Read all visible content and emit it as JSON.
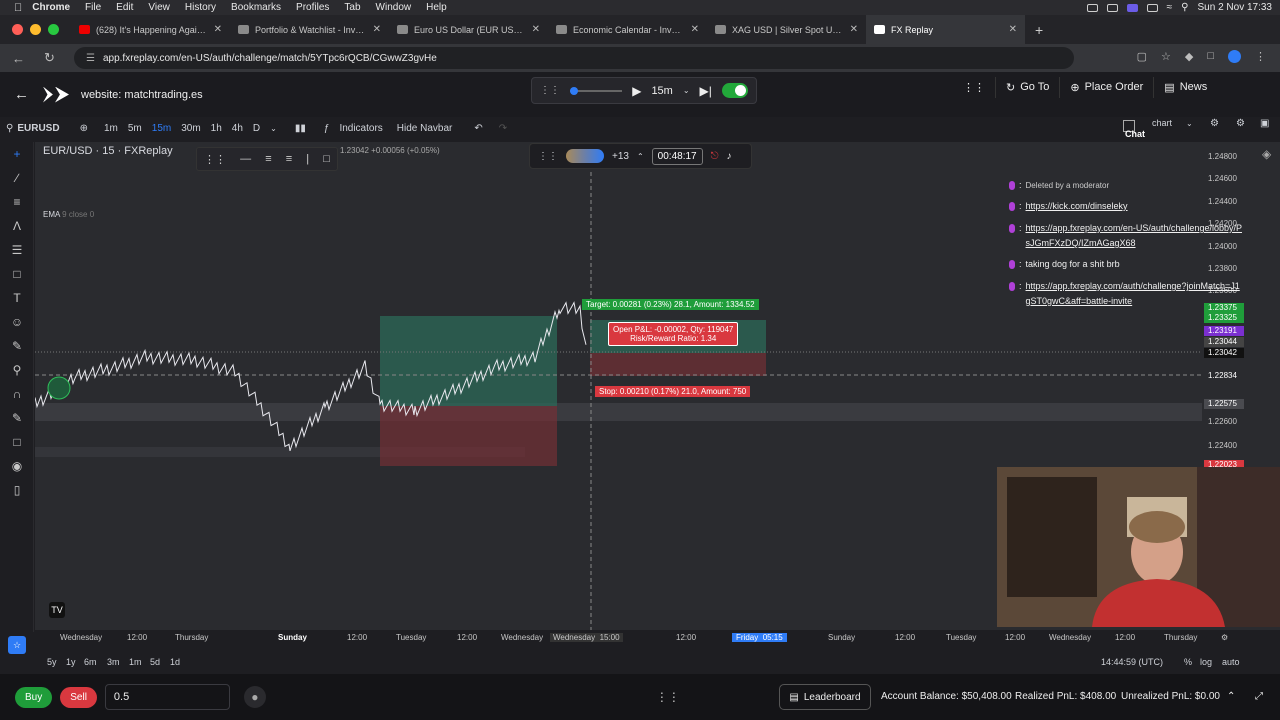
{
  "mac_menu": {
    "app": "Chrome",
    "items": [
      "File",
      "Edit",
      "View",
      "History",
      "Bookmarks",
      "Profiles",
      "Tab",
      "Window",
      "Help"
    ],
    "clock": "Sun 2 Nov  17:33"
  },
  "browser": {
    "tabs": [
      {
        "title": "(628) It's Happening Again a",
        "active": false
      },
      {
        "title": "Portfolio & Watchlist - Investi",
        "active": false
      },
      {
        "title": "Euro US Dollar (EUR USD) Ne",
        "active": false
      },
      {
        "title": "Economic Calendar - Investin",
        "active": false
      },
      {
        "title": "XAG USD | Silver Spot US Do",
        "active": false
      },
      {
        "title": "FX Replay",
        "active": true
      }
    ],
    "url": "app.fxreplay.com/en-US/auth/challenge/match/5YTpc6rQCB/CGwwZ3gvHe"
  },
  "header": {
    "site_label": "website: matchtrading.es",
    "timeframe": "15m",
    "go_to": "Go To",
    "place_order": "Place Order",
    "news": "News"
  },
  "toolbar": {
    "symbol": "EURUSD",
    "intervals": [
      "1m",
      "5m",
      "15m",
      "30m",
      "1h",
      "4h",
      "D"
    ],
    "active_interval": "15m",
    "indicators": "Indicators",
    "hide_navbar": "Hide Navbar",
    "chart_label": "chart",
    "chat_label": "Chat"
  },
  "chart": {
    "legend_symbol": "EUR/USD · 15 · FXReplay",
    "legend_change": "1.23042  +0.00056 (+0.05%)",
    "ema_label": "EMA",
    "ema_params": "9 close 0",
    "participants": "+13",
    "timer": "00:48:17",
    "target_label": "Target: 0.00281 (0.23%) 28.1, Amount: 1334.52",
    "pnl_line1": "Open P&L: -0.00002, Qty: 119047",
    "pnl_line2": "Risk/Reward Ratio: 1.34",
    "stop_label": "Stop: 0.00210 (0.17%) 21.0, Amount: 750",
    "y_ticks": [
      "1.24800",
      "1.24600",
      "1.24400",
      "1.24200",
      "1.24000",
      "1.23800",
      "1.23600",
      "1.23400",
      "1.23200",
      "1.22800",
      "1.22600",
      "1.22400",
      "1.22200"
    ],
    "y_tags": [
      {
        "v": "1.23375",
        "c": "#1f9d3a"
      },
      {
        "v": "1.23325",
        "c": "#1f9d3a"
      },
      {
        "v": "1.23191",
        "c": "#8a2be2"
      },
      {
        "v": "1.23044",
        "c": "#555"
      },
      {
        "v": "1.23042",
        "c": "#222"
      },
      {
        "v": "1.22834",
        "c": "#3a3a40"
      },
      {
        "v": "1.22575",
        "c": "#555"
      },
      {
        "v": "1.22023",
        "c": "#d9383f"
      }
    ],
    "x_ticks": [
      "Wednesday",
      "12:00",
      "Thursday",
      "Sunday",
      "12:00",
      "Tuesday",
      "12:00",
      "Wednesday",
      "Wednesday",
      "15:00",
      "12:00",
      "Friday",
      "05:15",
      "Sunday",
      "12:00",
      "Tuesday",
      "12:00",
      "Wednesday",
      "12:00",
      "Thursday"
    ]
  },
  "chat": {
    "messages": [
      {
        "text": "Deleted by a moderator",
        "link": false
      },
      {
        "text": "https://kick.com/dinseleky",
        "link": true
      },
      {
        "text": "https://app.fxreplay.com/en-US/auth/challenge/lobby/PsJGmFXzDQ/IZmAGagX68",
        "link": true
      },
      {
        "text": "taking dog for a shit brb",
        "link": false
      },
      {
        "text": "https://app.fxreplay.com/auth/challenge?joinMatch=J1gST0gwC&aff=battle-invite",
        "link": true
      }
    ]
  },
  "bottom": {
    "ranges": [
      "5y",
      "1y",
      "6m",
      "3m",
      "1m",
      "5d",
      "1d"
    ],
    "time": "14:44:59 (UTC)",
    "pct": "%",
    "log": "log",
    "auto": "auto"
  },
  "orders": {
    "buy": "Buy",
    "sell": "Sell",
    "qty": "0.5",
    "leaderboard": "Leaderboard",
    "account_balance": "Account Balance: $50,408.00",
    "realized": "Realized PnL: $408.00",
    "unrealized": "Unrealized PnL: $0.00"
  }
}
